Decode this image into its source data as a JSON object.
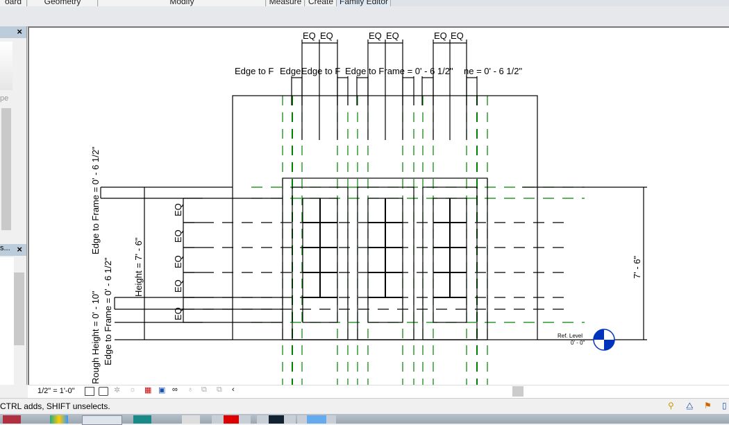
{
  "ribbon": {
    "tabs": [
      "oard",
      "Geometry",
      "Modify",
      "Measure",
      "Create",
      "Family Editor"
    ]
  },
  "left_panel": {
    "panel1_close": "×",
    "panel1_fragment": "pe",
    "panel2_title": "s...",
    "panel2_close": "×"
  },
  "drawing": {
    "eq": "EQ",
    "edge_to_frame_labels": [
      "Edge to F",
      "Edge",
      "Edge to F",
      "Edge to Frame = 0' - 6 1/2\"",
      "ne = 0' - 6 1/2\""
    ],
    "left_dims": {
      "edge_to_frame_top": "Edge to Frame = 0' - 6 1/2\"",
      "edge_to_frame_bottom": "Edge to Frame = 0' - 6 1/2\"",
      "rough_height": "Rough Height = 0' - 10\"",
      "height": "Height = 7' - 6\""
    },
    "right_dim": "7' - 6\"",
    "level": {
      "name": "Ref. Level",
      "elevation": "0' - 0\""
    },
    "colors": {
      "ref_plane": "#008000",
      "level_head": "#0033bb"
    }
  },
  "view_control": {
    "scale": "1/2\" = 1'-0\""
  },
  "status": {
    "message": "CTRL adds, SHIFT unselects."
  }
}
